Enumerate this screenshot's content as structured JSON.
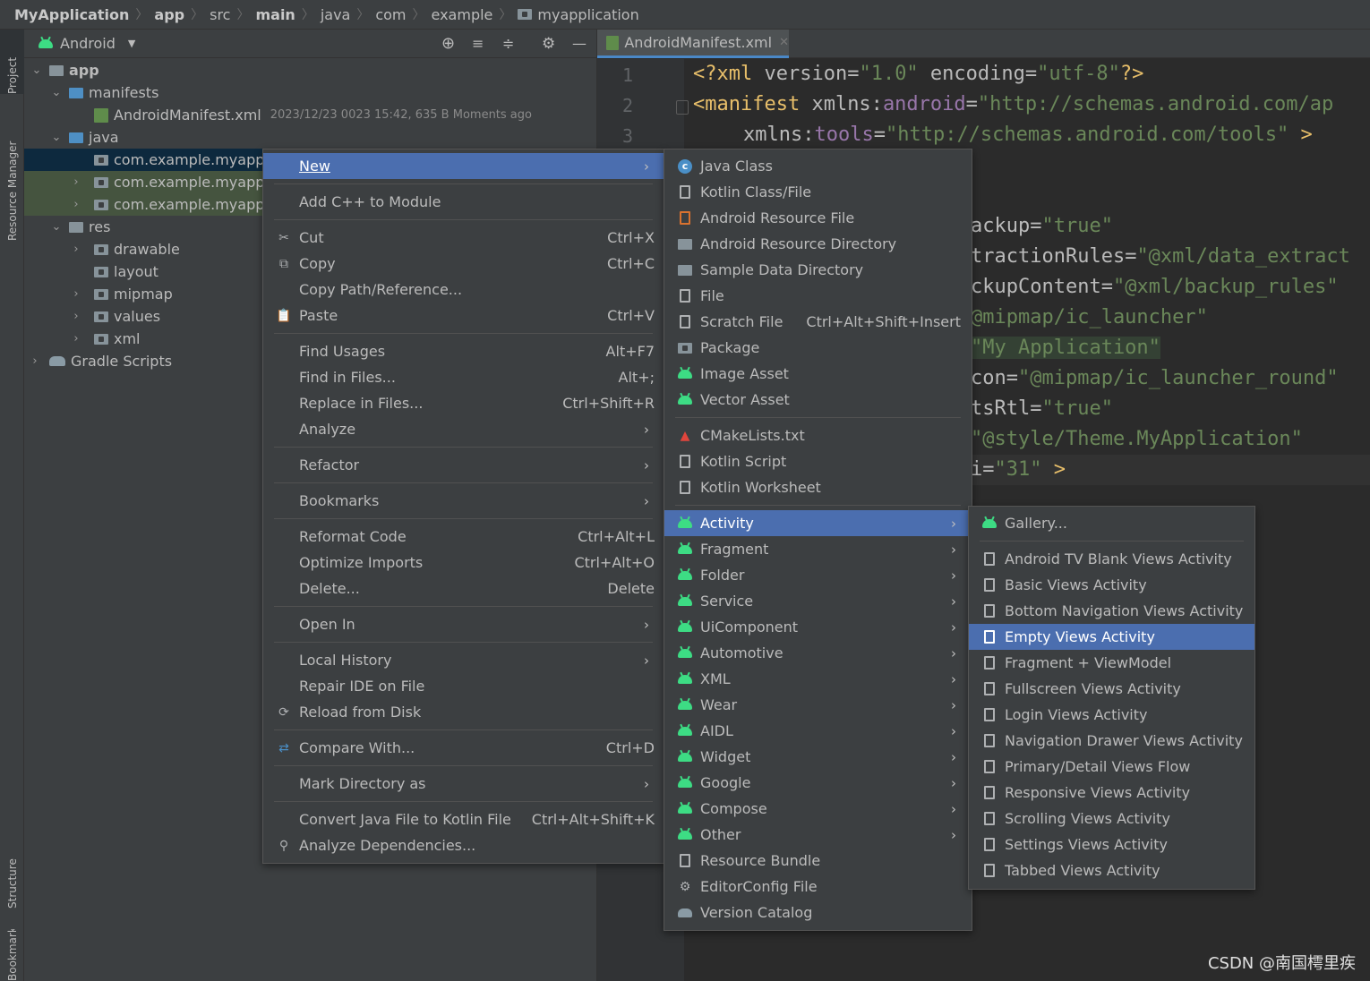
{
  "breadcrumb": {
    "items": [
      "MyApplication",
      "app",
      "src",
      "main",
      "java",
      "com",
      "example",
      "myapplication"
    ]
  },
  "project_header": {
    "view_label": "Android"
  },
  "side_tabs": {
    "project": "Project",
    "resource_manager": "Resource Manager",
    "structure": "Structure",
    "bookmarks": "Bookmarks"
  },
  "tree": {
    "app": "app",
    "manifests": "manifests",
    "manifest_file": "AndroidManifest.xml",
    "manifest_meta": "2023/12/23 0023 15:42, 635 B Moments ago",
    "java": "java",
    "pkg1": "com.example.myappli",
    "pkg2": "com.example.myappli",
    "pkg3": "com.example.myappli",
    "res": "res",
    "drawable": "drawable",
    "layout": "layout",
    "mipmap": "mipmap",
    "values": "values",
    "xml": "xml",
    "gradle": "Gradle Scripts"
  },
  "editor": {
    "tab_label": "AndroidManifest.xml",
    "line_numbers": [
      "1",
      "2",
      "3"
    ],
    "code": {
      "l1_a": "<?xml ",
      "l1_b": "version",
      "l1_c": "=",
      "l1_d": "\"1.0\"",
      "l1_e": " encoding",
      "l1_f": "=",
      "l1_g": "\"utf-8\"",
      "l1_h": "?>",
      "l2_a": "<manifest ",
      "l2_b": "xmlns:",
      "l2_c": "android",
      "l2_d": "=",
      "l2_e": "\"http://schemas.android.com/ap",
      "l3_a": "xmlns:",
      "l3_b": "tools",
      "l3_c": "=",
      "l3_d": "\"http://schemas.android.com/tools\"",
      "l3_e": " >",
      "p1_a": "ackup",
      "p1_b": "=",
      "p1_c": "\"true\"",
      "p2_a": "tractionRules",
      "p2_b": "=",
      "p2_c": "\"@xml/data_extract",
      "p3_a": "ckupContent",
      "p3_b": "=",
      "p3_c": "\"@xml/backup_rules\"",
      "p4_a": "@mipmap/ic_launcher\"",
      "p5_a": "\"My Application\"",
      "p6_a": "con",
      "p6_b": "=",
      "p6_c": "\"@mipmap/ic_launcher_round\"",
      "p7_a": "tsRtl",
      "p7_b": "=",
      "p7_c": "\"true\"",
      "p8_a": "\"@style/Theme.MyApplication\"",
      "p9_a": "i",
      "p9_b": "=",
      "p9_c": "\"31\"",
      "p9_d": " >"
    }
  },
  "context_menu": {
    "new": "New",
    "add_cpp": "Add C++ to Module",
    "cut": "Cut",
    "cut_sc": "Ctrl+X",
    "copy": "Copy",
    "copy_sc": "Ctrl+C",
    "copy_path": "Copy Path/Reference...",
    "paste": "Paste",
    "paste_sc": "Ctrl+V",
    "find_usages": "Find Usages",
    "find_usages_sc": "Alt+F7",
    "find_in_files": "Find in Files...",
    "find_in_files_sc": "Alt+;",
    "replace_in_files": "Replace in Files...",
    "replace_in_files_sc": "Ctrl+Shift+R",
    "analyze": "Analyze",
    "refactor": "Refactor",
    "bookmarks": "Bookmarks",
    "reformat": "Reformat Code",
    "reformat_sc": "Ctrl+Alt+L",
    "optimize": "Optimize Imports",
    "optimize_sc": "Ctrl+Alt+O",
    "delete": "Delete...",
    "delete_sc": "Delete",
    "open_in": "Open In",
    "local_history": "Local History",
    "repair": "Repair IDE on File",
    "reload": "Reload from Disk",
    "compare": "Compare With...",
    "compare_sc": "Ctrl+D",
    "mark_dir": "Mark Directory as",
    "convert": "Convert Java File to Kotlin File",
    "convert_sc": "Ctrl+Alt+Shift+K",
    "analyze_deps": "Analyze Dependencies..."
  },
  "new_menu": {
    "java_class": "Java Class",
    "kotlin_class": "Kotlin Class/File",
    "res_file": "Android Resource File",
    "res_dir": "Android Resource Directory",
    "sample_dir": "Sample Data Directory",
    "file": "File",
    "scratch": "Scratch File",
    "scratch_sc": "Ctrl+Alt+Shift+Insert",
    "package": "Package",
    "image_asset": "Image Asset",
    "vector_asset": "Vector Asset",
    "cmake": "CMakeLists.txt",
    "kotlin_script": "Kotlin Script",
    "kotlin_worksheet": "Kotlin Worksheet",
    "activity": "Activity",
    "fragment": "Fragment",
    "folder": "Folder",
    "service": "Service",
    "ui_component": "UiComponent",
    "automotive": "Automotive",
    "xml": "XML",
    "wear": "Wear",
    "aidl": "AIDL",
    "widget": "Widget",
    "google": "Google",
    "compose": "Compose",
    "other": "Other",
    "resource_bundle": "Resource Bundle",
    "editorconfig": "EditorConfig File",
    "version_catalog": "Version Catalog"
  },
  "activity_menu": {
    "gallery": "Gallery...",
    "items": [
      "Android TV Blank Views Activity",
      "Basic Views Activity",
      "Bottom Navigation Views Activity",
      "Empty Views Activity",
      "Fragment + ViewModel",
      "Fullscreen Views Activity",
      "Login Views Activity",
      "Navigation Drawer Views Activity",
      "Primary/Detail Views Flow",
      "Responsive Views Activity",
      "Scrolling Views Activity",
      "Settings Views Activity",
      "Tabbed Views Activity"
    ],
    "selected": "Empty Views Activity"
  },
  "watermark": "CSDN @南国樗里疾",
  "colors": {
    "accent": "#4b6eaf",
    "selection_tree": "#0d293e",
    "android_green": "#3ddc84",
    "xml_tag": "#e8bf6a",
    "xml_value": "#6a8759",
    "xml_ns": "#9876aa"
  }
}
